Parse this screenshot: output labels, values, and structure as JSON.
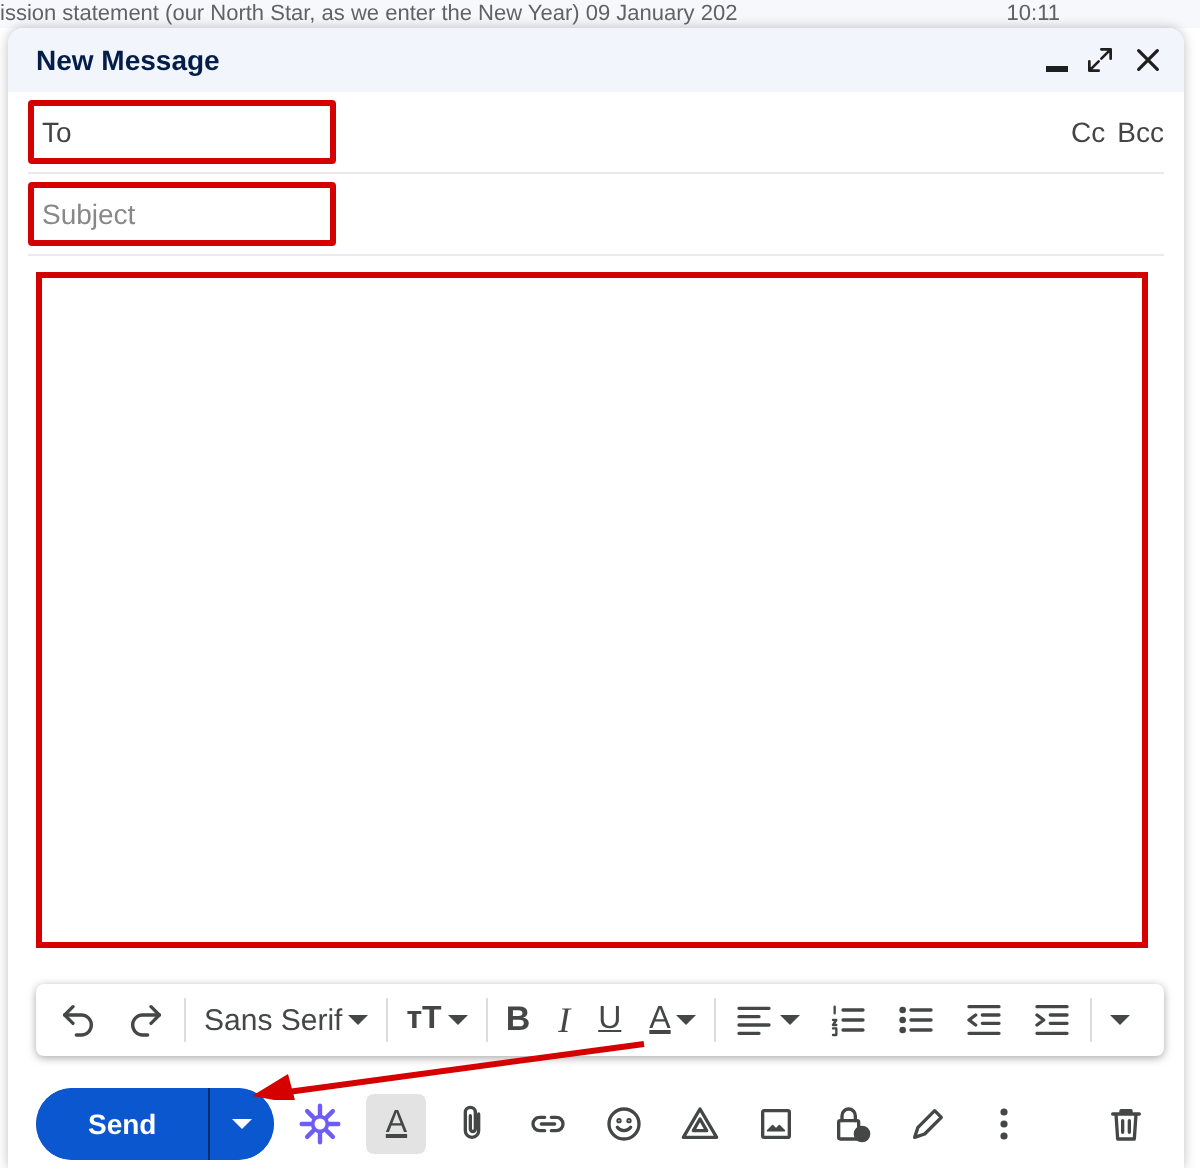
{
  "background_email": {
    "subject": "ission statement (our North Star, as we enter the New Year) 09 January 202",
    "time": "10:11"
  },
  "window": {
    "title": "New Message"
  },
  "to": {
    "placeholder": "To"
  },
  "recipient_links": [
    "Cc",
    "Bcc"
  ],
  "subject": {
    "placeholder": "Subject"
  },
  "format_toolbar": [
    {
      "kind": "undo"
    },
    {
      "kind": "redo"
    },
    {
      "kind": "font",
      "label": "Sans Serif"
    },
    {
      "kind": "size",
      "label": "тT"
    },
    {
      "kind": "bold",
      "label": "B"
    },
    {
      "kind": "italic",
      "label": "I"
    },
    {
      "kind": "underline",
      "label": "U"
    },
    {
      "kind": "color",
      "label": "A"
    },
    {
      "kind": "align"
    },
    {
      "kind": "numbered"
    },
    {
      "kind": "bulleted"
    },
    {
      "kind": "outdent"
    },
    {
      "kind": "indent"
    },
    {
      "kind": "more"
    }
  ],
  "send": {
    "label": "Send"
  },
  "actions": [
    {
      "kind": "sparkle",
      "selected": false
    },
    {
      "kind": "format",
      "label": "A",
      "selected": true
    },
    {
      "kind": "attach",
      "selected": false
    },
    {
      "kind": "link",
      "selected": false
    },
    {
      "kind": "emoji",
      "selected": false
    },
    {
      "kind": "drive",
      "selected": false
    },
    {
      "kind": "photo",
      "selected": false
    },
    {
      "kind": "lock",
      "selected": false
    },
    {
      "kind": "pen",
      "selected": false
    },
    {
      "kind": "more",
      "selected": false
    }
  ],
  "trash": {
    "kind": "trash"
  }
}
